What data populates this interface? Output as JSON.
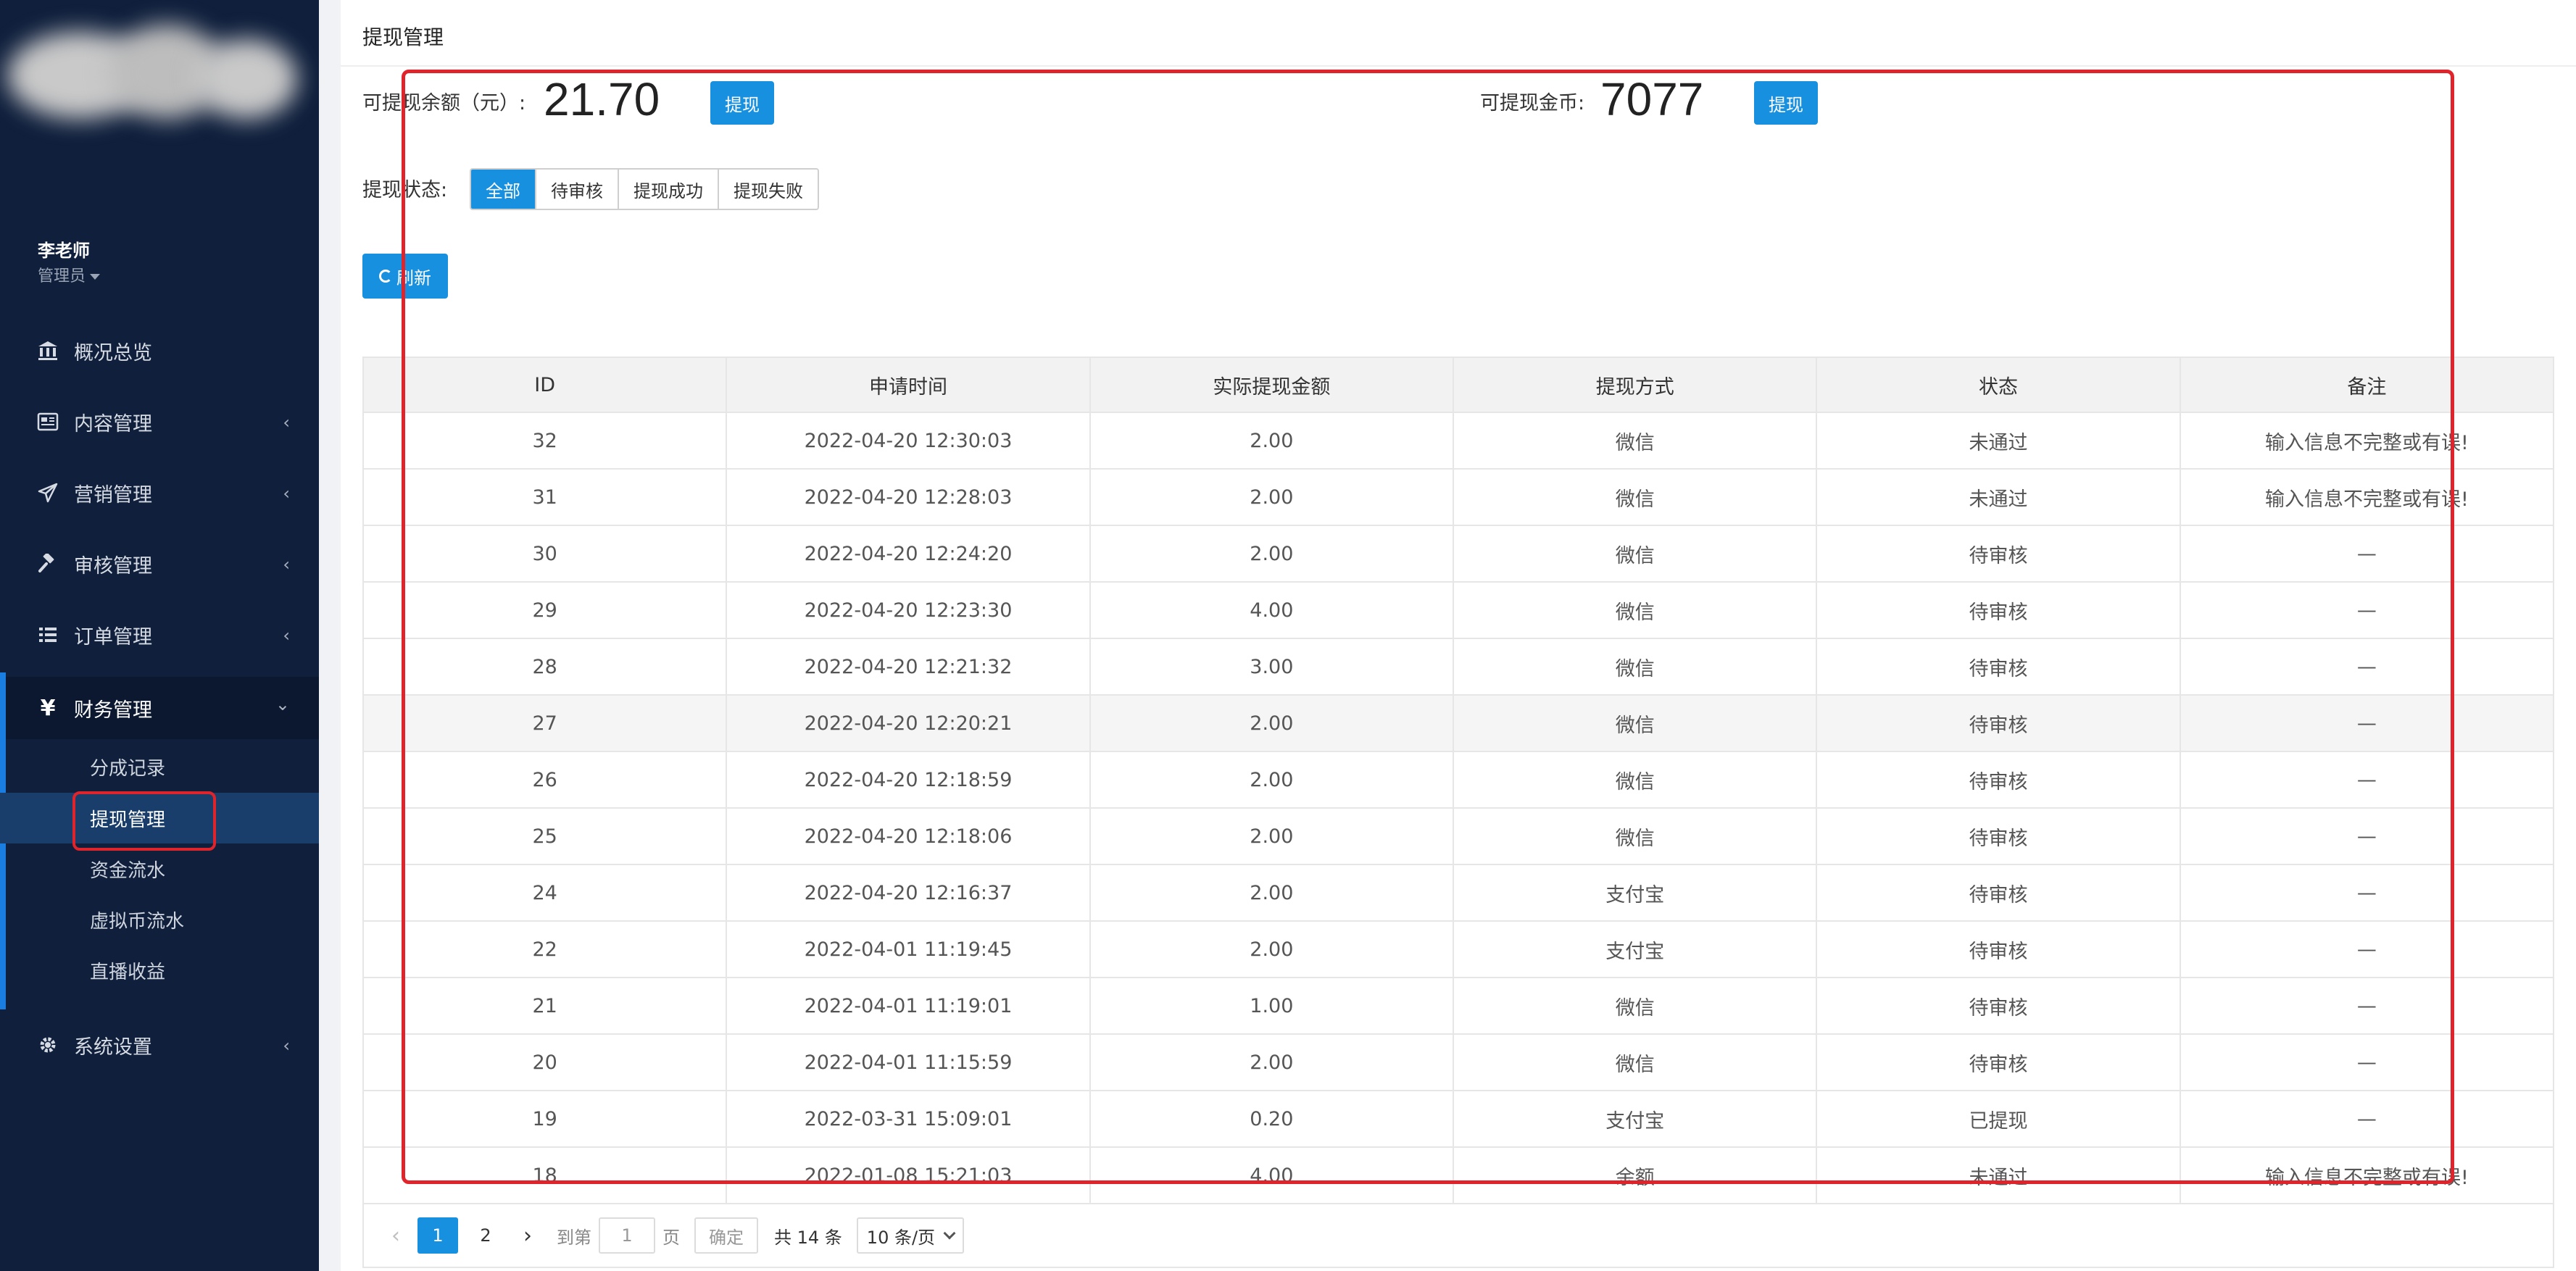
{
  "sidebar": {
    "user": {
      "name": "李老师",
      "role": "管理员"
    },
    "menu": [
      {
        "label": "概况总览",
        "icon": "bank-icon"
      },
      {
        "label": "内容管理",
        "icon": "newspaper-icon"
      },
      {
        "label": "营销管理",
        "icon": "send-icon"
      },
      {
        "label": "审核管理",
        "icon": "gavel-icon"
      },
      {
        "label": "订单管理",
        "icon": "list-icon"
      },
      {
        "label": "财务管理",
        "icon": "yen-icon"
      },
      {
        "label": "系统设置",
        "icon": "gear-icon"
      }
    ],
    "finance_sub": [
      {
        "label": "分成记录"
      },
      {
        "label": "提现管理"
      },
      {
        "label": "资金流水"
      },
      {
        "label": "虚拟币流水"
      },
      {
        "label": "直播收益"
      }
    ]
  },
  "main": {
    "title": "提现管理",
    "balance": {
      "label": "可提现余额（元）:",
      "value": "21.70",
      "button": "提现"
    },
    "coins": {
      "label": "可提现金币:",
      "value": "7077",
      "button": "提现"
    },
    "filter": {
      "label": "提现状态:",
      "options": [
        "全部",
        "待审核",
        "提现成功",
        "提现失败"
      ],
      "selected": "全部"
    },
    "refresh_label": "刷新",
    "table": {
      "headers": [
        "ID",
        "申请时间",
        "实际提现金额",
        "提现方式",
        "状态",
        "备注"
      ],
      "rows": [
        [
          "32",
          "2022-04-20 12:30:03",
          "2.00",
          "微信",
          "未通过",
          "输入信息不完整或有误!"
        ],
        [
          "31",
          "2022-04-20 12:28:03",
          "2.00",
          "微信",
          "未通过",
          "输入信息不完整或有误!"
        ],
        [
          "30",
          "2022-04-20 12:24:20",
          "2.00",
          "微信",
          "待审核",
          "—"
        ],
        [
          "29",
          "2022-04-20 12:23:30",
          "4.00",
          "微信",
          "待审核",
          "—"
        ],
        [
          "28",
          "2022-04-20 12:21:32",
          "3.00",
          "微信",
          "待审核",
          "—"
        ],
        [
          "27",
          "2022-04-20 12:20:21",
          "2.00",
          "微信",
          "待审核",
          "—"
        ],
        [
          "26",
          "2022-04-20 12:18:59",
          "2.00",
          "微信",
          "待审核",
          "—"
        ],
        [
          "25",
          "2022-04-20 12:18:06",
          "2.00",
          "微信",
          "待审核",
          "—"
        ],
        [
          "24",
          "2022-04-20 12:16:37",
          "2.00",
          "支付宝",
          "待审核",
          "—"
        ],
        [
          "22",
          "2022-04-01 11:19:45",
          "2.00",
          "支付宝",
          "待审核",
          "—"
        ],
        [
          "21",
          "2022-04-01 11:19:01",
          "1.00",
          "微信",
          "待审核",
          "—"
        ],
        [
          "20",
          "2022-04-01 11:15:59",
          "2.00",
          "微信",
          "待审核",
          "—"
        ],
        [
          "19",
          "2022-03-31 15:09:01",
          "0.20",
          "支付宝",
          "已提现",
          "—"
        ],
        [
          "18",
          "2022-01-08 15:21:03",
          "4.00",
          "余额",
          "未通过",
          "输入信息不完整或有误!"
        ]
      ]
    },
    "pager": {
      "pages": [
        "1",
        "2"
      ],
      "current": "1",
      "goto_label": "到第",
      "goto_value": "1",
      "page_unit": "页",
      "confirm": "确定",
      "total": "共 14 条",
      "page_size": "10 条/页"
    }
  },
  "colors": {
    "primary": "#1890e0",
    "sidebar": "#0f1f3c",
    "annotation": "#e0242b"
  }
}
